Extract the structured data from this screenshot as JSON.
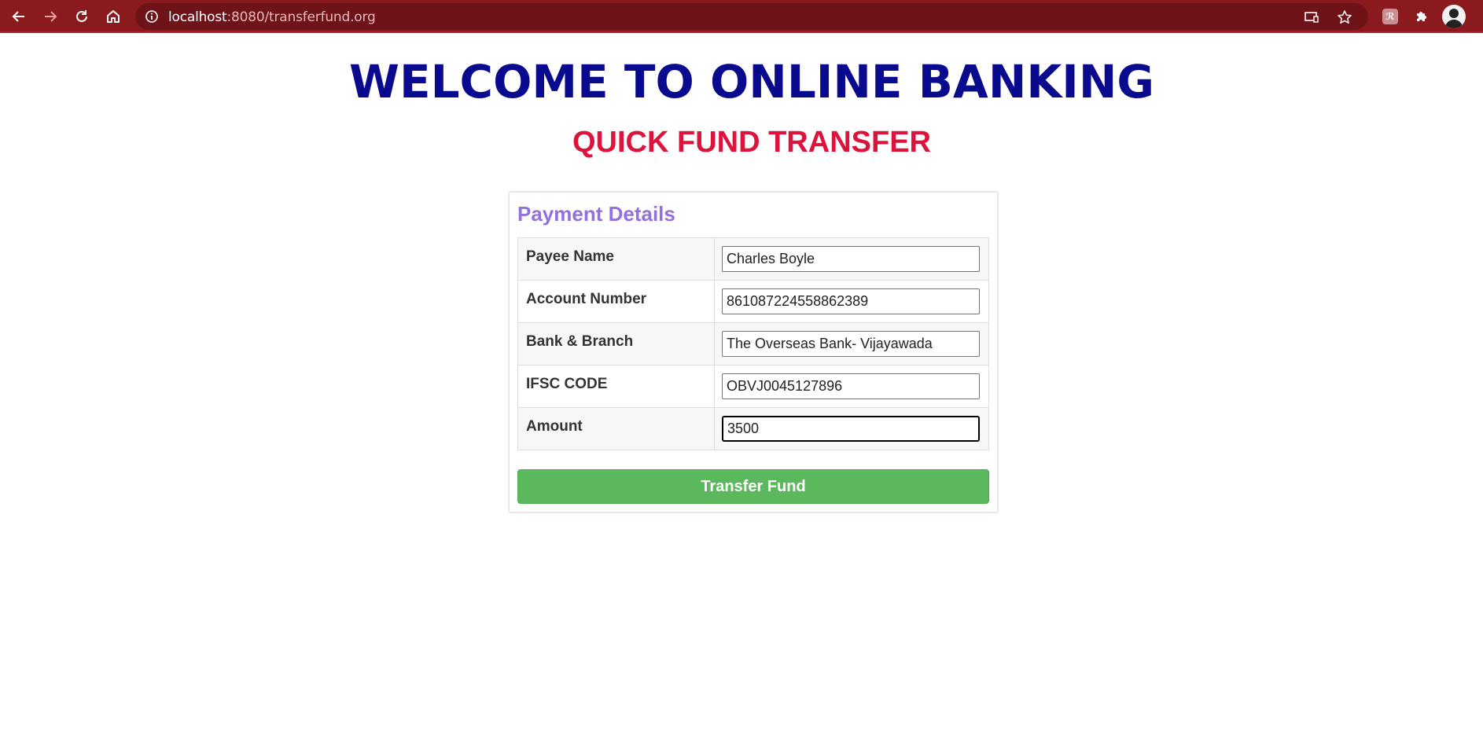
{
  "browser": {
    "url_host": "localhost",
    "url_rest": ":8080/transferfund.org"
  },
  "page": {
    "heading": "WELCOME TO ONLINE BANKING",
    "subheading": "QUICK FUND TRANSFER"
  },
  "form": {
    "title": "Payment Details",
    "fields": [
      {
        "label": "Payee Name",
        "value": "Charles Boyle"
      },
      {
        "label": "Account Number",
        "value": "861087224558862389"
      },
      {
        "label": "Bank & Branch",
        "value": "The Overseas Bank- Vijayawada"
      },
      {
        "label": "IFSC CODE",
        "value": "OBVJ0045127896"
      },
      {
        "label": "Amount",
        "value": "3500"
      }
    ],
    "submit_label": "Transfer Fund"
  },
  "colors": {
    "chrome": "#8b1a1f",
    "heading": "#0a0a8e",
    "subheading": "#dc143c",
    "panel_title": "#9370db",
    "button": "#5cb85c"
  },
  "icons": {
    "back": "back-arrow-icon",
    "forward": "forward-arrow-icon",
    "reload": "reload-icon",
    "home": "home-icon",
    "site_info": "info-icon",
    "cast": "cast-icon",
    "bookmark": "star-icon",
    "extension_badge": "extension-badge-icon",
    "extensions": "puzzle-icon",
    "profile": "avatar"
  }
}
